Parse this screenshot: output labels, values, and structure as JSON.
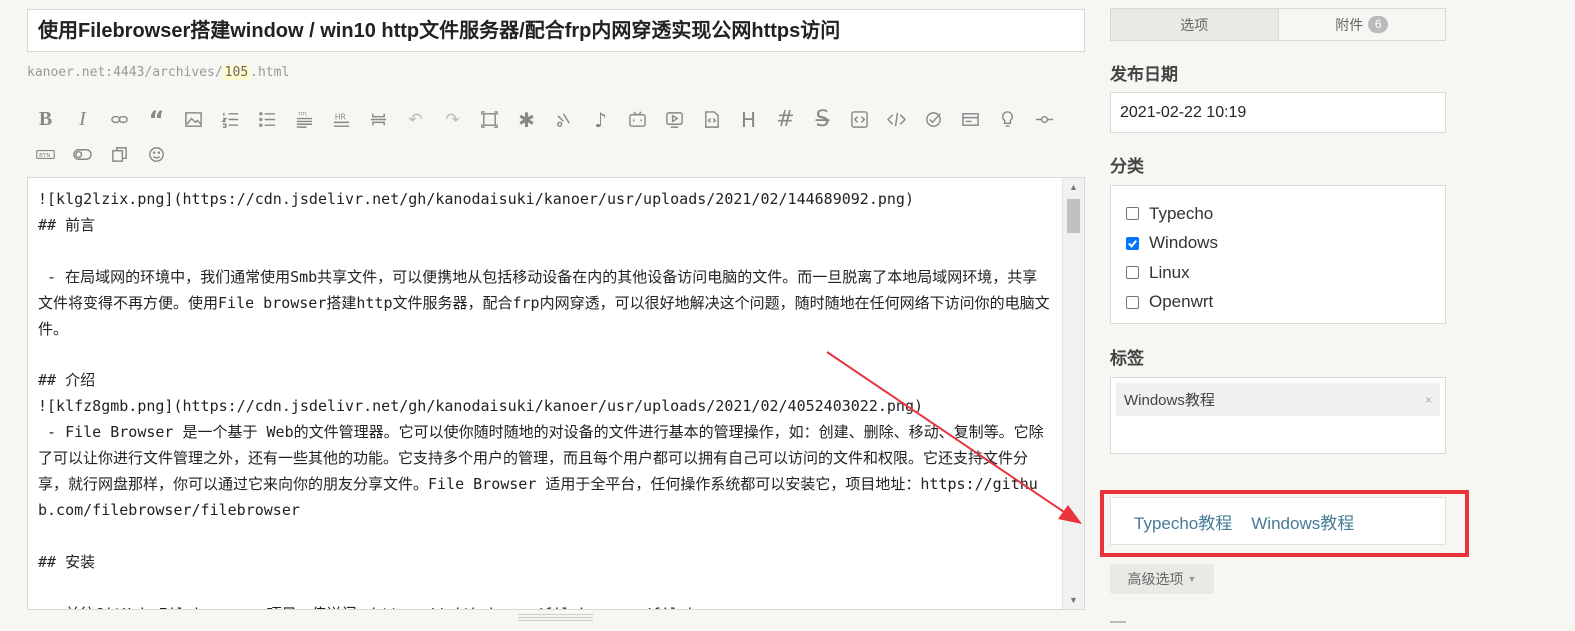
{
  "post": {
    "title": "使用Filebrowser搭建window / win10 http文件服务器/配合frp内网穿透实现公网https访问",
    "permalink_prefix": "kanoer.net:4443/archives/",
    "permalink_slug": "105",
    "permalink_suffix": ".html"
  },
  "toolbar": {
    "row1": [
      "bold-icon",
      "italic-icon",
      "link-icon",
      "quote-icon",
      "image-icon",
      "ordered-list-icon",
      "unordered-list-icon",
      "title-icon",
      "hr-icon",
      "more-icon",
      "undo-icon",
      "redo-icon",
      "fullscreen-icon",
      "asterisk-icon",
      "music-link-icon",
      "music-note-icon",
      "bilibili-icon",
      "video-icon",
      "file-code-icon",
      "heading-icon",
      "hashtag-icon",
      "strikethrough-icon",
      "code-icon",
      "code-block-icon",
      "check-icon",
      "card-icon",
      "lightbulb-icon",
      "slider-icon"
    ],
    "row2": [
      "btn-icon",
      "toggle-icon",
      "copy-icon",
      "emoji-icon"
    ],
    "labels": {
      "btn": "BTN",
      "hr": "HR",
      "title": "TITL"
    }
  },
  "editor": {
    "content": "![klg2lzix.png](https://cdn.jsdelivr.net/gh/kanodaisuki/kanoer/usr/uploads/2021/02/144689092.png)\n## 前言\n\n - 在局域网的环境中，我们通常使用Smb共享文件，可以便携地从包括移动设备在内的其他设备访问电脑的文件。而一旦脱离了本地局域网环境，共享文件将变得不再方便。使用File browser搭建http文件服务器，配合frp内网穿透，可以很好地解决这个问题，随时随地在任何网络下访问你的电脑文件。\n\n## 介绍\n![klfz8gmb.png](https://cdn.jsdelivr.net/gh/kanodaisuki/kanoer/usr/uploads/2021/02/4052403022.png)\n - File Browser 是一个基于 Web的文件管理器。它可以使你随时随地的对设备的文件进行基本的管理操作，如：创建、删除、移动、复制等。它除了可以让你进行文件管理之外，还有一些其他的功能。它支持多个用户的管理，而且每个用户都可以拥有自己可以访问的文件和权限。它还支持文件分享，就行网盘那样，你可以通过它来向你的朋友分享文件。File Browser 适用于全平台，任何操作系统都可以安装它，项目地址：https://github.com/filebrowser/filebrowser\n\n## 安装\n\n - 前往GitHub Filebrowser 项目，传送门：https://github.com/filebrowser/filebrowser"
  },
  "sidebar": {
    "tabs": [
      {
        "label": "选项"
      },
      {
        "label": "附件",
        "badge": "6"
      }
    ],
    "publish_date_label": "发布日期",
    "publish_date": "2021-02-22 10:19",
    "category_label": "分类",
    "categories": [
      {
        "label": "Typecho",
        "checked": false
      },
      {
        "label": "Windows",
        "checked": true
      },
      {
        "label": "Linux",
        "checked": false
      },
      {
        "label": "Openwrt",
        "checked": false
      }
    ],
    "tag_label": "标签",
    "tags": [
      {
        "label": "Windows教程",
        "remove": "×"
      }
    ],
    "tag_suggestions": [
      "Typecho教程",
      "Windows教程"
    ],
    "advanced_label": "高级选项",
    "advanced_caret": "▼"
  },
  "colors": {
    "annotation_red": "#e8343b",
    "link": "#467b96",
    "checkbox_blue": "#0075ff"
  }
}
